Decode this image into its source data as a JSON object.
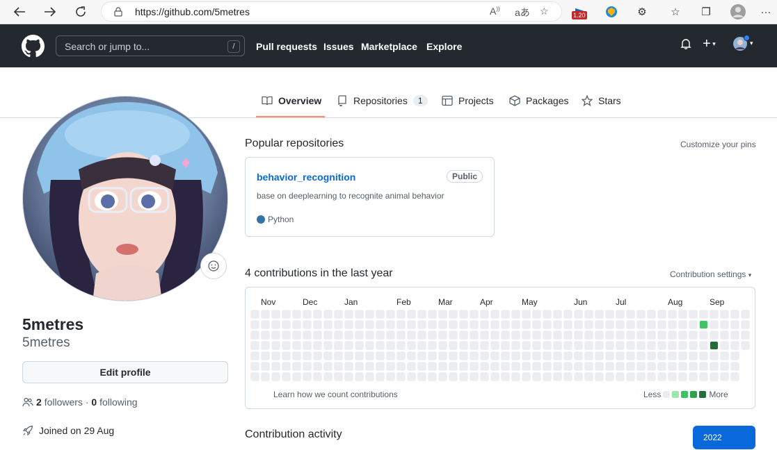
{
  "browser": {
    "url": "https://github.com/5metres",
    "ext_badge": "1.20"
  },
  "header": {
    "search_placeholder": "Search or jump to...",
    "search_shortcut": "/",
    "nav": [
      "Pull requests",
      "Issues",
      "Marketplace",
      "Explore"
    ]
  },
  "tabs": [
    {
      "label": "Overview",
      "icon": "book-icon"
    },
    {
      "label": "Repositories",
      "icon": "repo-icon",
      "count": "1"
    },
    {
      "label": "Projects",
      "icon": "table-icon"
    },
    {
      "label": "Packages",
      "icon": "package-icon"
    },
    {
      "label": "Stars",
      "icon": "star-icon"
    }
  ],
  "profile": {
    "name": "5metres",
    "login": "5metres",
    "edit_label": "Edit profile",
    "followers_count": "2",
    "followers_label": "followers",
    "following_count": "0",
    "following_label": "following",
    "joined": "Joined on 29 Aug"
  },
  "popular": {
    "title": "Popular repositories",
    "customize": "Customize your pins",
    "repos": [
      {
        "name": "behavior_recognition",
        "visibility": "Public",
        "description": "base on deeplearning to recognite animal behavior",
        "language": "Python",
        "language_color": "#3572A5"
      }
    ]
  },
  "contributions": {
    "title": "4 contributions in the last year",
    "settings": "Contribution settings",
    "months": [
      "Nov",
      "Dec",
      "Jan",
      "Feb",
      "Mar",
      "Apr",
      "May",
      "Jun",
      "Jul",
      "Aug",
      "Sep"
    ],
    "learn": "Learn how we count contributions",
    "less": "Less",
    "more": "More",
    "legend_colors": [
      "#ebedf0",
      "#9be9a8",
      "#40c463",
      "#30a14e",
      "#216e39"
    ]
  },
  "activity": {
    "title": "Contribution activity",
    "year": "2022"
  }
}
